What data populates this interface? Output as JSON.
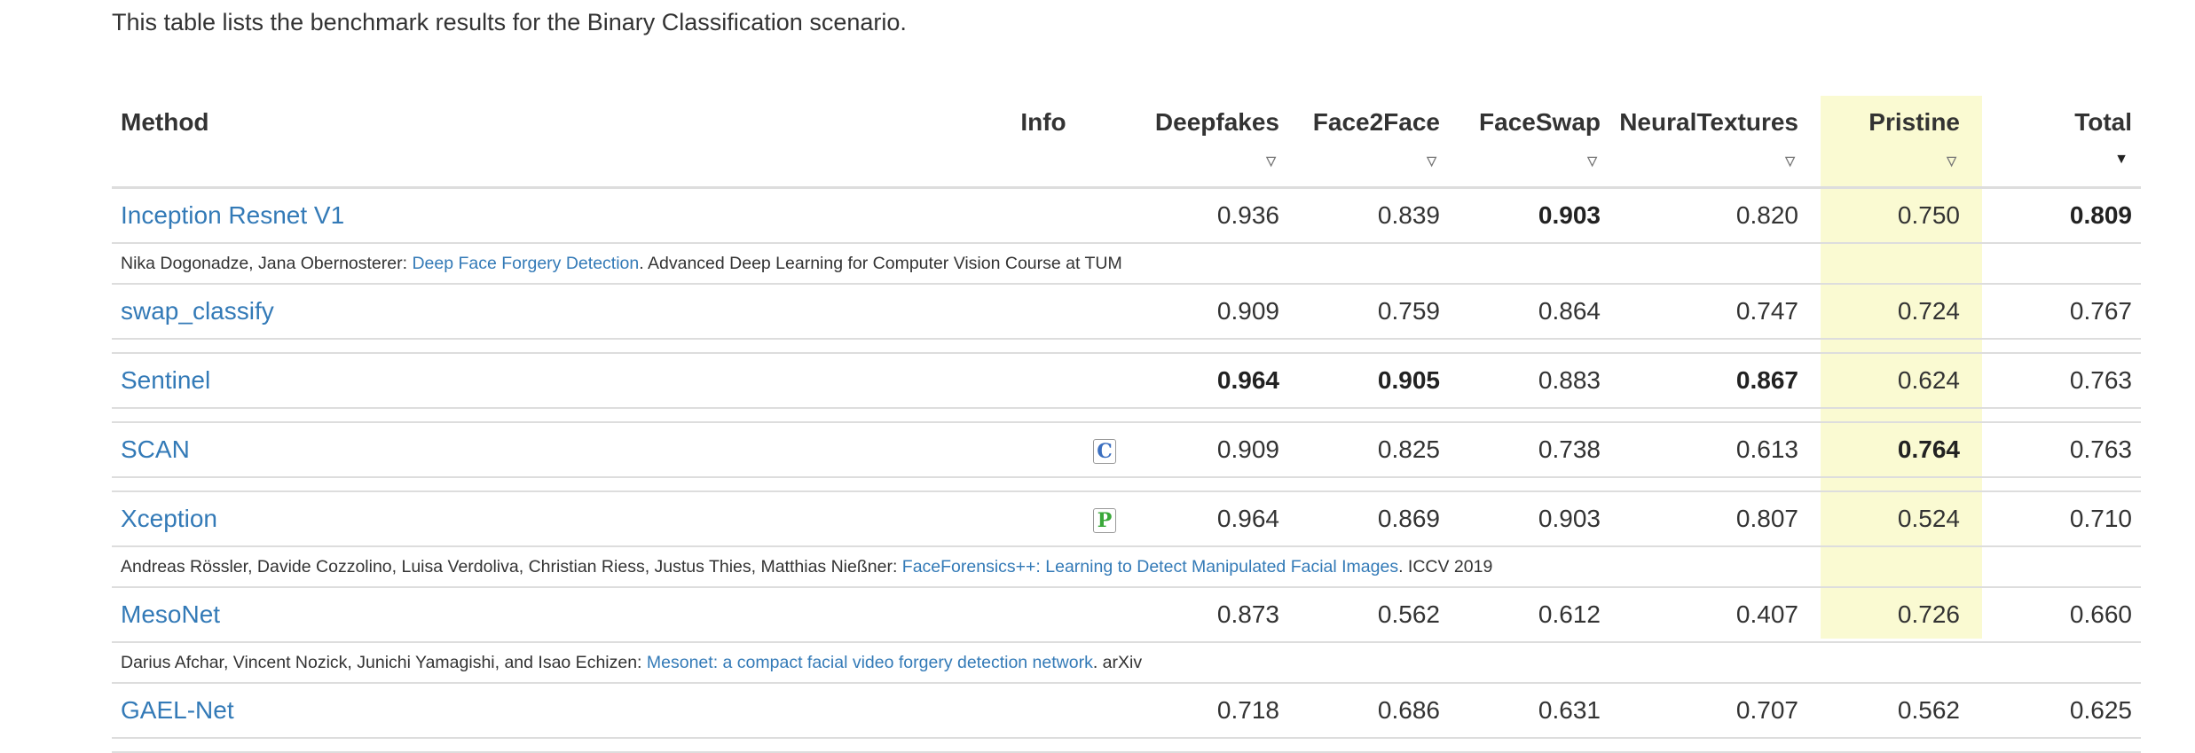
{
  "intro": "This table lists the benchmark results for the Binary Classification scenario.",
  "colors": {
    "link": "#337ab7",
    "pristine_highlight": "#fafad2",
    "border": "#dddddd"
  },
  "columns": {
    "method": "Method",
    "info": "Info",
    "deepfakes": "Deepfakes",
    "face2face": "Face2Face",
    "faceswap": "FaceSwap",
    "neuraltextures": "NeuralTextures",
    "pristine": "Pristine",
    "total": "Total"
  },
  "sort": {
    "icon": "sort-triangle-icon",
    "active_column": "Total"
  },
  "rows": [
    {
      "name": "Inception Resnet V1",
      "values": [
        "0.936",
        "0.839",
        "0.903",
        "0.820",
        "0.750",
        "0.809"
      ],
      "bold": [
        false,
        false,
        true,
        false,
        false,
        true
      ],
      "ref": {
        "authors": "Nika Dogonadze, Jana Obernosterer: ",
        "link": "Deep Face Forgery Detection",
        "venue": ". Advanced Deep Learning for Computer Vision Course at TUM"
      }
    },
    {
      "name": "swap_classify",
      "values": [
        "0.909",
        "0.759",
        "0.864",
        "0.747",
        "0.724",
        "0.767"
      ],
      "bold": [
        false,
        false,
        false,
        false,
        false,
        false
      ]
    },
    {
      "name": "Sentinel",
      "values": [
        "0.964",
        "0.905",
        "0.883",
        "0.867",
        "0.624",
        "0.763"
      ],
      "bold": [
        true,
        true,
        false,
        true,
        false,
        false
      ]
    },
    {
      "name": "SCAN",
      "badge": "C",
      "values": [
        "0.909",
        "0.825",
        "0.738",
        "0.613",
        "0.764",
        "0.763"
      ],
      "bold": [
        false,
        false,
        false,
        false,
        true,
        false
      ]
    },
    {
      "name": "Xception",
      "badge": "P",
      "values": [
        "0.964",
        "0.869",
        "0.903",
        "0.807",
        "0.524",
        "0.710"
      ],
      "bold": [
        false,
        false,
        false,
        false,
        false,
        false
      ],
      "ref": {
        "authors": "Andreas Rössler, Davide Cozzolino, Luisa Verdoliva, Christian Riess, Justus Thies, Matthias Nießner: ",
        "link": "FaceForensics++: Learning to Detect Manipulated Facial Images",
        "venue": ". ICCV 2019"
      }
    },
    {
      "name": "MesoNet",
      "values": [
        "0.873",
        "0.562",
        "0.612",
        "0.407",
        "0.726",
        "0.660"
      ],
      "bold": [
        false,
        false,
        false,
        false,
        false,
        false
      ],
      "ref": {
        "authors": "Darius Afchar, Vincent Nozick, Junichi Yamagishi, and Isao Echizen: ",
        "link": "Mesonet: a compact facial video forgery detection network",
        "venue": ". arXiv"
      }
    },
    {
      "name": "GAEL-Net",
      "values": [
        "0.718",
        "0.686",
        "0.631",
        "0.707",
        "0.562",
        "0.625"
      ],
      "bold": [
        false,
        false,
        false,
        false,
        false,
        false
      ]
    }
  ]
}
